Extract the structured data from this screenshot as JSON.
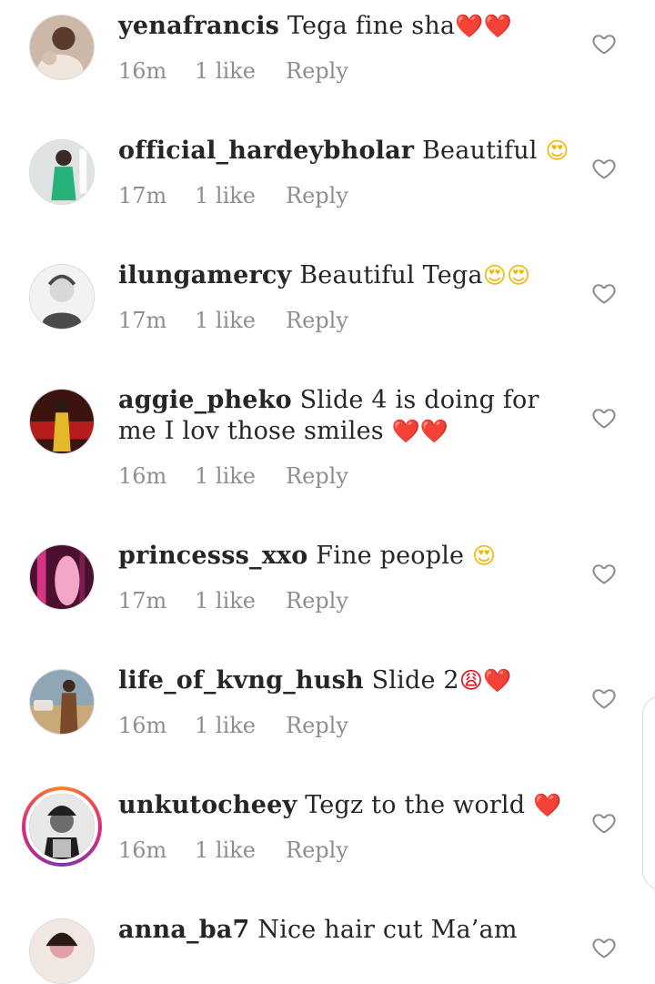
{
  "comments": [
    {
      "username": "yenafrancis",
      "text": " Tega fine sha",
      "emoji": "❤️❤️",
      "emoji_kind": "heart",
      "time": "16m",
      "likes": "1 like",
      "reply": "Reply",
      "avatar_colors": [
        "#cbb8a8",
        "#f1e6dc",
        "#5a3b2e"
      ]
    },
    {
      "username": "official_hardeybholar",
      "text": " Beautiful ",
      "emoji": "😍",
      "emoji_kind": "face",
      "time": "17m",
      "likes": "1 like",
      "reply": "Reply",
      "avatar_colors": [
        "#dfe3e3",
        "#27b27a",
        "#3a2a24"
      ]
    },
    {
      "username": "ilungamercy",
      "text": " Beautiful Tega",
      "emoji": "😍😍",
      "emoji_kind": "face",
      "time": "17m",
      "likes": "1 like",
      "reply": "Reply",
      "avatar_colors": [
        "#f2f2f2",
        "#d8d8d8",
        "#4a4a4a"
      ]
    },
    {
      "username": "aggie_pheko",
      "text": " Slide 4 is doing for me I lov those smiles ",
      "emoji": "❤️❤️",
      "emoji_kind": "heart",
      "time": "16m",
      "likes": "1 like",
      "reply": "Reply",
      "avatar_colors": [
        "#3b1410",
        "#b51d1d",
        "#e3b92b"
      ]
    },
    {
      "username": "princesss_xxo",
      "text": " Fine people ",
      "emoji": "😍",
      "emoji_kind": "face",
      "time": "17m",
      "likes": "1 like",
      "reply": "Reply",
      "avatar_colors": [
        "#4b0f2f",
        "#d63384",
        "#f4a6c8"
      ]
    },
    {
      "username": "life_of_kvng_hush",
      "text": " Slide 2",
      "emoji": "😩❤️",
      "emoji_kind": "mixed",
      "time": "16m",
      "likes": "1 like",
      "reply": "Reply",
      "avatar_colors": [
        "#8fa7b5",
        "#c9a87a",
        "#3d2a1c"
      ]
    },
    {
      "username": "unkutocheey",
      "text": " Tegz to the world ",
      "emoji": "❤️",
      "emoji_kind": "heart",
      "time": "16m",
      "likes": "1 like",
      "reply": "Reply",
      "avatar_colors": [
        "#e8e8e8",
        "#6d6d6d",
        "#1f1f1f"
      ],
      "story_ring": true
    },
    {
      "username": "anna_ba7",
      "text": " Nice hair cut Ma’am",
      "emoji": "",
      "emoji_kind": "none",
      "time": "",
      "likes": "",
      "reply": "",
      "avatar_colors": [
        "#f1e7e3",
        "#e0a0a6",
        "#2b1a14"
      ]
    }
  ],
  "icons": {
    "like": "heart-outline-icon"
  },
  "colors": {
    "username": "#262626",
    "meta": "#8e8e8e",
    "heart": "#e0131e"
  }
}
